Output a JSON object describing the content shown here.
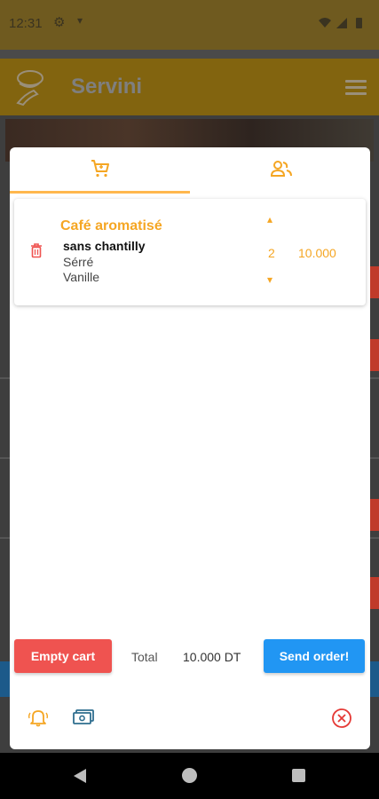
{
  "status_bar": {
    "time": "12:31",
    "settings_icon": "gear-icon"
  },
  "app_bar": {
    "title": "Servini",
    "logo_icon": "servini-logo-icon",
    "menu_icon": "hamburger-icon"
  },
  "cart": {
    "tabs": [
      {
        "icon": "cart-icon",
        "active": true
      },
      {
        "icon": "users-icon",
        "active": false
      }
    ],
    "items": [
      {
        "name": "Café aromatisé",
        "options": [
          "sans chantilly",
          "Sérré",
          "Vanille"
        ],
        "quantity": "2",
        "price": "10.000"
      }
    ],
    "footer": {
      "empty_label": "Empty cart",
      "total_label": "Total",
      "total_value": "10.000 DT",
      "send_label": "Send order!"
    },
    "bottom_icons": [
      "bell-icon",
      "money-icon",
      "close-circle-icon"
    ]
  },
  "colors": {
    "accent": "#f5a623",
    "danger": "#ef5350",
    "primary": "#2196f3"
  }
}
